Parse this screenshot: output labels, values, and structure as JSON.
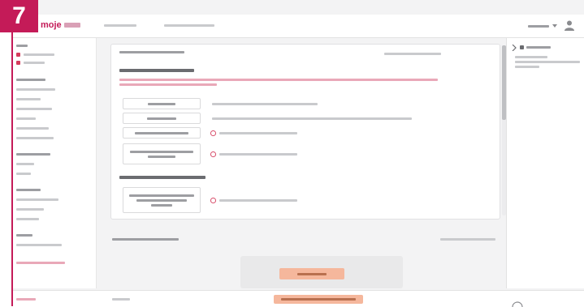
{
  "step_number": "7",
  "app": {
    "logo_word": "moje"
  },
  "colors": {
    "brand": "#c41b58",
    "accent_button": "#f5b79c",
    "error_text": "#d43c5c"
  },
  "icons": [
    "user-icon",
    "chevron-down-icon",
    "warning-icon",
    "chevron-right-icon",
    "chevron-left-icon"
  ]
}
